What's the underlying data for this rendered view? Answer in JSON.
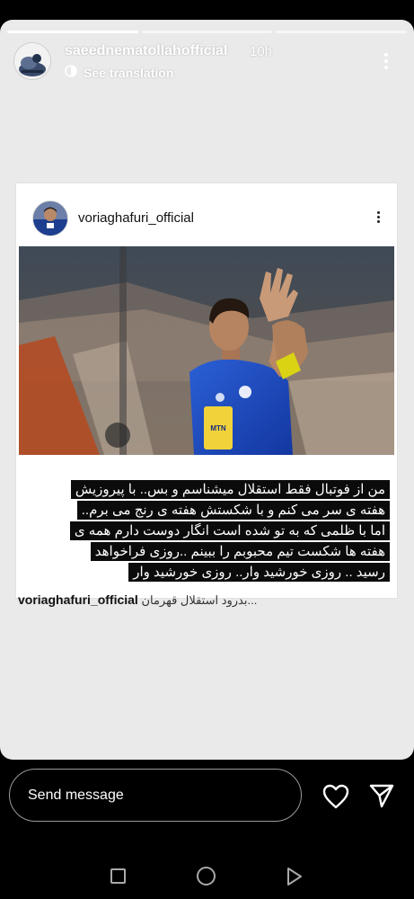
{
  "story": {
    "username": "saeednematollahofficial",
    "time": "10h",
    "translate_label": "See translation"
  },
  "post": {
    "username": "voriaghafuri_official",
    "caption_lines": [
      "من از فوتبال فقط استقلال میشناسم و بس.. با پیروزیش",
      "هفته ی سر می کنم و با شکستش هفته ی رنج می برم..",
      "اما با ظلمی که به تو شده است انگار دوست دارم همه ی",
      "هفته ها شکست تیم محبوبم را ببینم ..روزی فراخواهد",
      "رسید .. روزی خورشید وار.. روزی خورشید وار"
    ],
    "footer_user": "voriaghafuri_official",
    "footer_text": "بدرود استقلال قهرمان..."
  },
  "photo": {
    "sponsor_text": "MTN"
  },
  "reply": {
    "placeholder": "Send message"
  },
  "icons": {
    "like": "heart-icon",
    "send": "paper-plane-icon",
    "translate": "translate-icon",
    "more": "more-vertical-icon"
  }
}
